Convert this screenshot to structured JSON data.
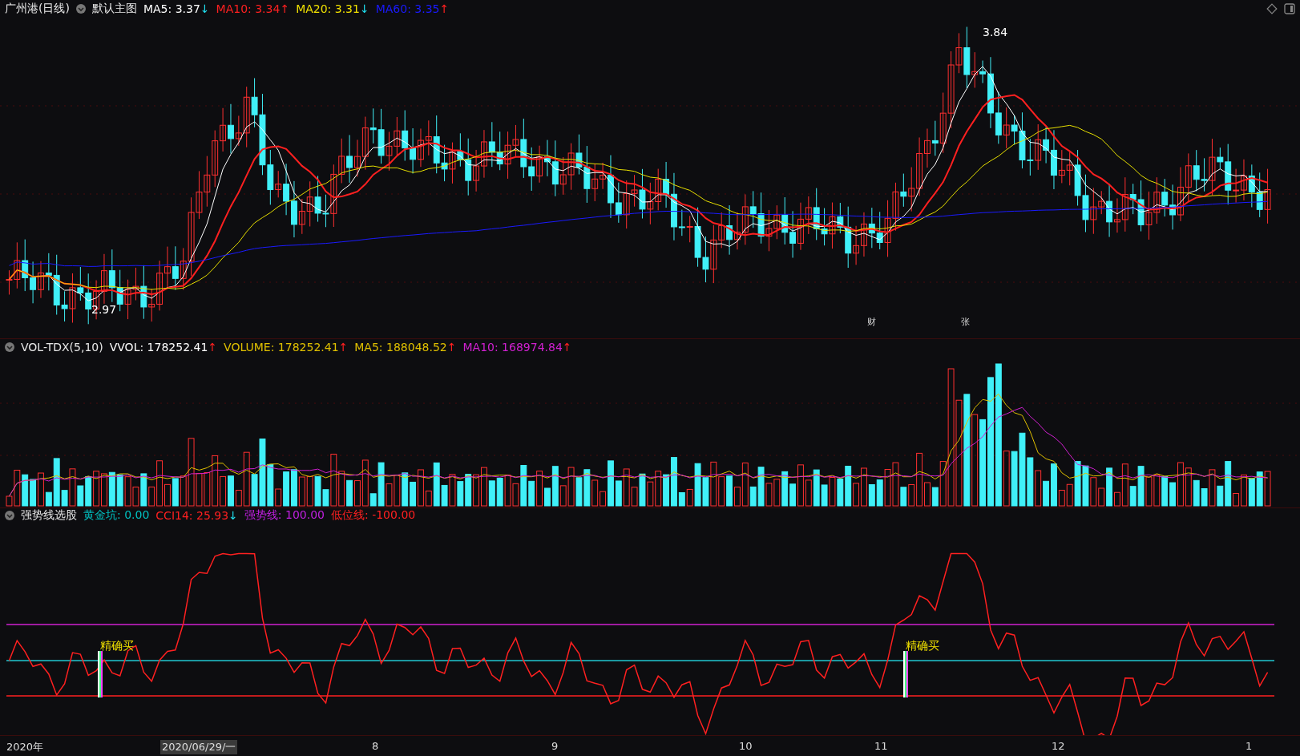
{
  "main_panel": {
    "title": "广州港(日线)",
    "template": "默认主图",
    "indicators": [
      {
        "label": "MA5: 3.37",
        "arrow": "↓",
        "rising": false,
        "color": "#ffffff"
      },
      {
        "label": "MA10: 3.34",
        "arrow": "↑",
        "rising": true,
        "color": "#ff2020"
      },
      {
        "label": "MA20: 3.31",
        "arrow": "↓",
        "rising": false,
        "color": "#f0e000"
      },
      {
        "label": "MA60: 3.35",
        "arrow": "↑",
        "rising": true,
        "color": "#1a1aff"
      }
    ],
    "annotations": [
      {
        "kind": "high",
        "text": "3.84"
      },
      {
        "kind": "low",
        "text": "2.97"
      },
      {
        "kind": "event",
        "text": "财"
      },
      {
        "kind": "event",
        "text": "张"
      }
    ]
  },
  "volume_panel": {
    "title": "VOL-TDX(5,10)",
    "indicators": [
      {
        "label": "VVOL: 178252.41",
        "arrow": "↑",
        "rising": true,
        "color": "#ffffff"
      },
      {
        "label": "VOLUME: 178252.41",
        "arrow": "↑",
        "rising": true,
        "color": "#e0c000"
      },
      {
        "label": "MA5: 188048.52",
        "arrow": "↑",
        "rising": true,
        "color": "#e0c000"
      },
      {
        "label": "MA10: 168974.84",
        "arrow": "↑",
        "rising": true,
        "color": "#d020d0"
      }
    ]
  },
  "indicator_panel": {
    "title": "强势线选股",
    "indicators": [
      {
        "label": "黄金坑: 0.00",
        "color": "#00c0c0"
      },
      {
        "label": "CCI14: 25.93",
        "arrow": "↓",
        "rising": false,
        "color": "#ff2020"
      },
      {
        "label": "强势线: 100.00",
        "color": "#c020e0"
      },
      {
        "label": "低位线: -100.00",
        "color": "#ff2020"
      }
    ],
    "signals": [
      {
        "text": "精确买"
      },
      {
        "text": "精确买"
      }
    ]
  },
  "time_axis": [
    {
      "text": "2020年",
      "selected": false
    },
    {
      "text": "2020/06/29/一",
      "selected": true
    },
    {
      "text": "8",
      "selected": false
    },
    {
      "text": "9",
      "selected": false
    },
    {
      "text": "10",
      "selected": false
    },
    {
      "text": "11",
      "selected": false
    },
    {
      "text": "12",
      "selected": false
    },
    {
      "text": "1",
      "selected": false
    }
  ]
}
